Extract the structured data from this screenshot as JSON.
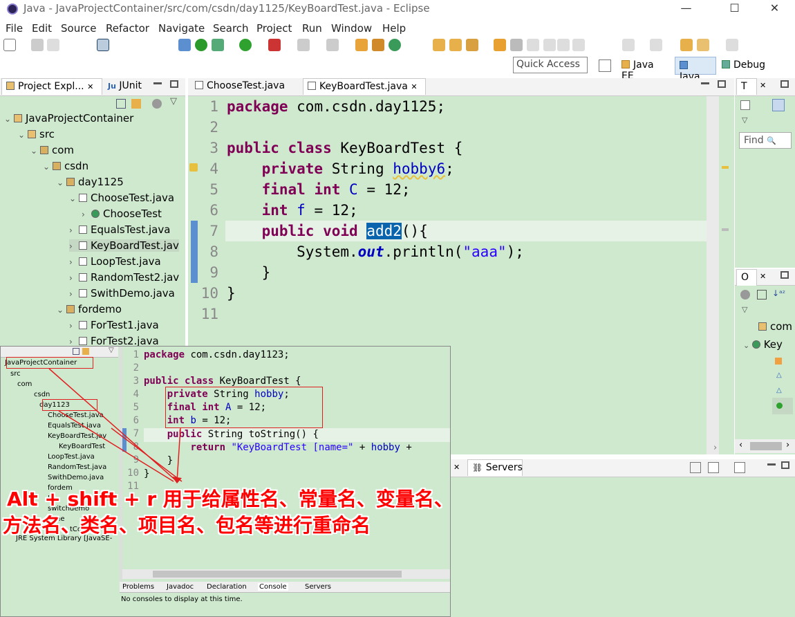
{
  "window": {
    "title": "Java - JavaProjectContainer/src/com/csdn/day1125/KeyBoardTest.java - Eclipse",
    "min": "—",
    "max": "☐",
    "close": "✕"
  },
  "menu": [
    "File",
    "Edit",
    "Source",
    "Refactor",
    "Navigate",
    "Search",
    "Project",
    "Run",
    "Window",
    "Help"
  ],
  "quick_access": "Quick Access",
  "perspectives": [
    "Java EE",
    "Java",
    "Debug"
  ],
  "left_panel": {
    "tabs": [
      "Project Expl...",
      "JUnit"
    ],
    "tree": [
      {
        "label": "JavaProjectContainer",
        "level": 0,
        "arrow": "⌄"
      },
      {
        "label": "src",
        "level": 1,
        "arrow": "⌄"
      },
      {
        "label": "com",
        "level": 2,
        "arrow": "⌄"
      },
      {
        "label": "csdn",
        "level": 3,
        "arrow": "⌄"
      },
      {
        "label": "day1125",
        "level": 4,
        "arrow": "⌄"
      },
      {
        "label": "ChooseTest.java",
        "level": 5,
        "arrow": "⌄"
      },
      {
        "label": "ChooseTest",
        "level": 6,
        "arrow": "›"
      },
      {
        "label": "EqualsTest.java",
        "level": 5,
        "arrow": "›"
      },
      {
        "label": "KeyBoardTest.jav",
        "level": 5,
        "arrow": "›"
      },
      {
        "label": "LoopTest.java",
        "level": 5,
        "arrow": "›"
      },
      {
        "label": "RandomTest2.jav",
        "level": 5,
        "arrow": "›"
      },
      {
        "label": "SwithDemo.java",
        "level": 5,
        "arrow": "›"
      },
      {
        "label": "fordemo",
        "level": 4,
        "arrow": "⌄"
      },
      {
        "label": "ForTest1.java",
        "level": 5,
        "arrow": "›"
      },
      {
        "label": "ForTest2.java",
        "level": 5,
        "arrow": "›"
      }
    ]
  },
  "editor": {
    "tabs": [
      "ChooseTest.java",
      "KeyBoardTest.java"
    ],
    "line_numbers": [
      "1",
      "2",
      "3",
      "4",
      "5",
      "6",
      "7",
      "8",
      "9",
      "10",
      "11"
    ]
  },
  "right_panel": {
    "tab1": "T",
    "find": "Find",
    "tab2": "O",
    "items": [
      "com",
      "Key"
    ]
  },
  "bottom_panel": {
    "tab": "Servers"
  },
  "overlay": {
    "tree": [
      "JavaProjectContainer",
      "src",
      "com",
      "csdn",
      "day1123",
      "ChooseTest.java",
      "EqualsTest.java",
      "KeyBoardTest.jav",
      "KeyBoardTest",
      "LoopTest.java",
      "RandomTest.java",
      "SwithDemo.java",
      "fordem",
      "Je",
      "switchdemo",
      "ne",
      "tCo",
      "JRE System Library [JavaSE-"
    ],
    "line_numbers": [
      "1",
      "2",
      "3",
      "4",
      "5",
      "6",
      "7",
      "8",
      "9",
      "10",
      "11"
    ],
    "bottom_tabs": [
      "Problems",
      "Javadoc",
      "Declaration",
      "Console",
      "Servers"
    ],
    "console_msg": "No consoles to display at this time."
  },
  "caption": {
    "line1": "Alt + shift + r 用于给属性名、常量名、变量名、",
    "line2": "方法名、类名、项目名、包名等进行重命名"
  }
}
